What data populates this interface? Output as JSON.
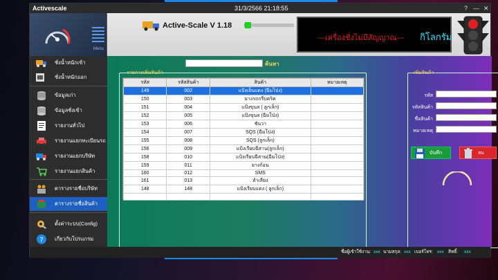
{
  "window": {
    "title": "Activescale",
    "datetime": "31/3/2566 21:18:55",
    "controls": [
      "?",
      "—",
      "✕"
    ]
  },
  "header": {
    "version": "Active-Scale V 1.18",
    "progress": 0.12,
    "lcd_message": "---เครื่องชั่งไม่มีสัญญาณ---",
    "lcd_unit": "กิโลกรัม",
    "menu_label": "Menu"
  },
  "sidebar": {
    "items": [
      {
        "label": "ชั่งน้ำหนักเข้า"
      },
      {
        "label": "ชั่งน้ำหนักออก"
      },
      {
        "label": "ข้อมูลเก่า"
      },
      {
        "label": "ข้อมูลชั่งเข้า"
      },
      {
        "label": "รายงานทั่วไป"
      },
      {
        "label": "รายงานแยกทะเบียนรถ"
      },
      {
        "label": "รายงานแยกบริษัท"
      },
      {
        "label": "รายงานแยกสินค้า"
      },
      {
        "label": "ตารางรายชื่อบริษัท"
      },
      {
        "label": "ตารางรายชื่อสินค้า"
      },
      {
        "label": "ตั้งค่าระบบ(Config)"
      },
      {
        "label": "เกี่ยวกับโปรแกรม"
      }
    ]
  },
  "search": {
    "value": "",
    "label": "ค้นหา"
  },
  "list_group": {
    "title": "รายการเพิ่มสินค้า",
    "columns": [
      "รหัส",
      "รหัสสินค้า",
      "สินค้า",
      "หมายเหตุ"
    ],
    "rows": [
      [
        "149",
        "002",
        "แป้งเย็นแดง (ฉีมโป่ง)",
        ""
      ],
      [
        "150",
        "003",
        "ยางรถกรีบคริค",
        ""
      ],
      [
        "151",
        "004",
        "แป้งขุนล ( ลูกเล็ก)",
        ""
      ],
      [
        "152",
        "005",
        "แป้งขุนล (ฉีมโป่ง)",
        ""
      ],
      [
        "153",
        "006",
        "ชันวา",
        ""
      ],
      [
        "154",
        "007",
        "SQS (ฉีมโป่ง)",
        ""
      ],
      [
        "155",
        "008",
        "SQS (ลูกเล็ก)",
        ""
      ],
      [
        "156",
        "009",
        "แป้งเรียบฉีสาน(ลูกเล็ก)",
        ""
      ],
      [
        "158",
        "010",
        "แป้งเรียบฉีสาน(ฉีมโป่ง)",
        ""
      ],
      [
        "159",
        "011",
        "ยางก้อน",
        ""
      ],
      [
        "160",
        "012",
        "SMS",
        ""
      ],
      [
        "161",
        "013",
        "ลำเลียง",
        ""
      ],
      [
        "148",
        "148",
        "แป้งเรียบแดง ( ลูกเล็ก)",
        ""
      ]
    ],
    "selected_index": 0
  },
  "form_group": {
    "title": "เพิ่มสินค้า",
    "fields": [
      {
        "label": "รหัส",
        "value": ""
      },
      {
        "label": "รหัสสินค้า",
        "value": ""
      },
      {
        "label": "ชื่อสินค้า",
        "value": ""
      },
      {
        "label": "หมายเหตุ",
        "value": ""
      }
    ],
    "save_label": "บันทึก",
    "delete_label": "ลบ"
  },
  "statusbar": {
    "user_label": "ชื่อผู้เข้าใช้งาน:",
    "user_value": "xxx",
    "position_label": "นามสกุล:",
    "position_value": "xxx",
    "phone_label": "เบอร์โทร:",
    "phone_value": "xxx",
    "status_label": "สิทธิ์:",
    "status_value": "xxx"
  },
  "colors": {
    "accent": "#1e88e5",
    "selected_row": "#1e6fe0",
    "lcd_text": "#e42020",
    "lcd_unit": "#36e4ff"
  }
}
